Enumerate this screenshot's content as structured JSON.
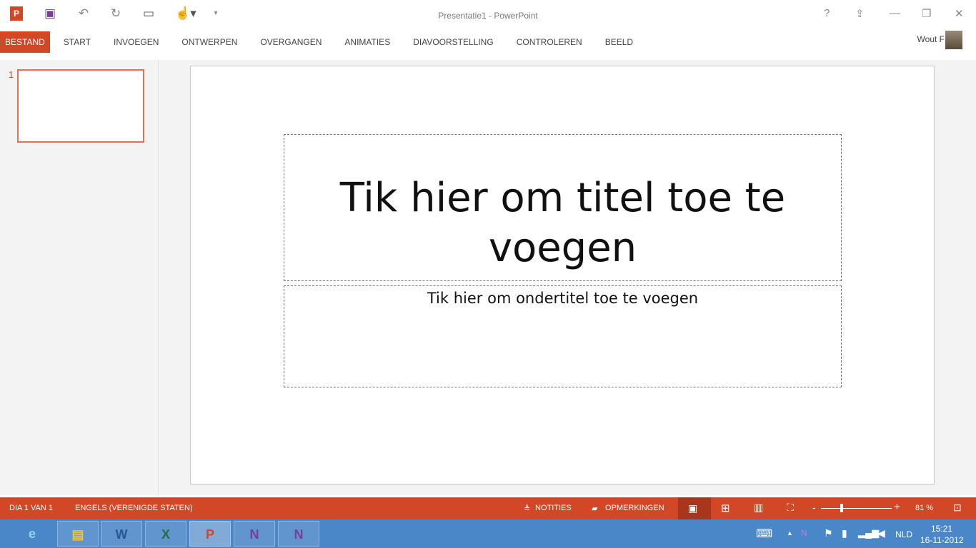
{
  "window": {
    "title": "Presentatie1 - PowerPoint"
  },
  "qat": {
    "app_icon": "powerpoint-icon",
    "save": "save-icon",
    "undo": "undo-icon",
    "redo": "redo-icon",
    "present": "start-slideshow-icon",
    "touch": "touch-mode-icon",
    "customize": "customize-qat-icon"
  },
  "ribbon": {
    "tabs": [
      "BESTAND",
      "START",
      "INVOEGEN",
      "ONTWERPEN",
      "OVERGANGEN",
      "ANIMATIES",
      "DIAVOORSTELLING",
      "CONTROLEREN",
      "BEELD"
    ],
    "user": "Wout F"
  },
  "thumbnails": [
    {
      "number": "1"
    }
  ],
  "slide": {
    "title_placeholder": "Tik hier om titel toe te voegen",
    "subtitle_placeholder": "Tik hier om ondertitel toe te voegen"
  },
  "status": {
    "slide_info": "DIA 1 VAN 1",
    "language": "ENGELS (VERENIGDE STATEN)",
    "notes": "NOTITIES",
    "comments": "OPMERKINGEN",
    "zoom": "81 %",
    "zoom_fraction": 0.27
  },
  "taskbar": {
    "apps": [
      "IE",
      "Explorer",
      "W",
      "X",
      "P",
      "N",
      "N"
    ],
    "lang": "NLD",
    "time": "15:21",
    "date": "16-11-2012"
  },
  "colors": {
    "accent": "#d24726",
    "taskbar": "#4a87c8"
  }
}
